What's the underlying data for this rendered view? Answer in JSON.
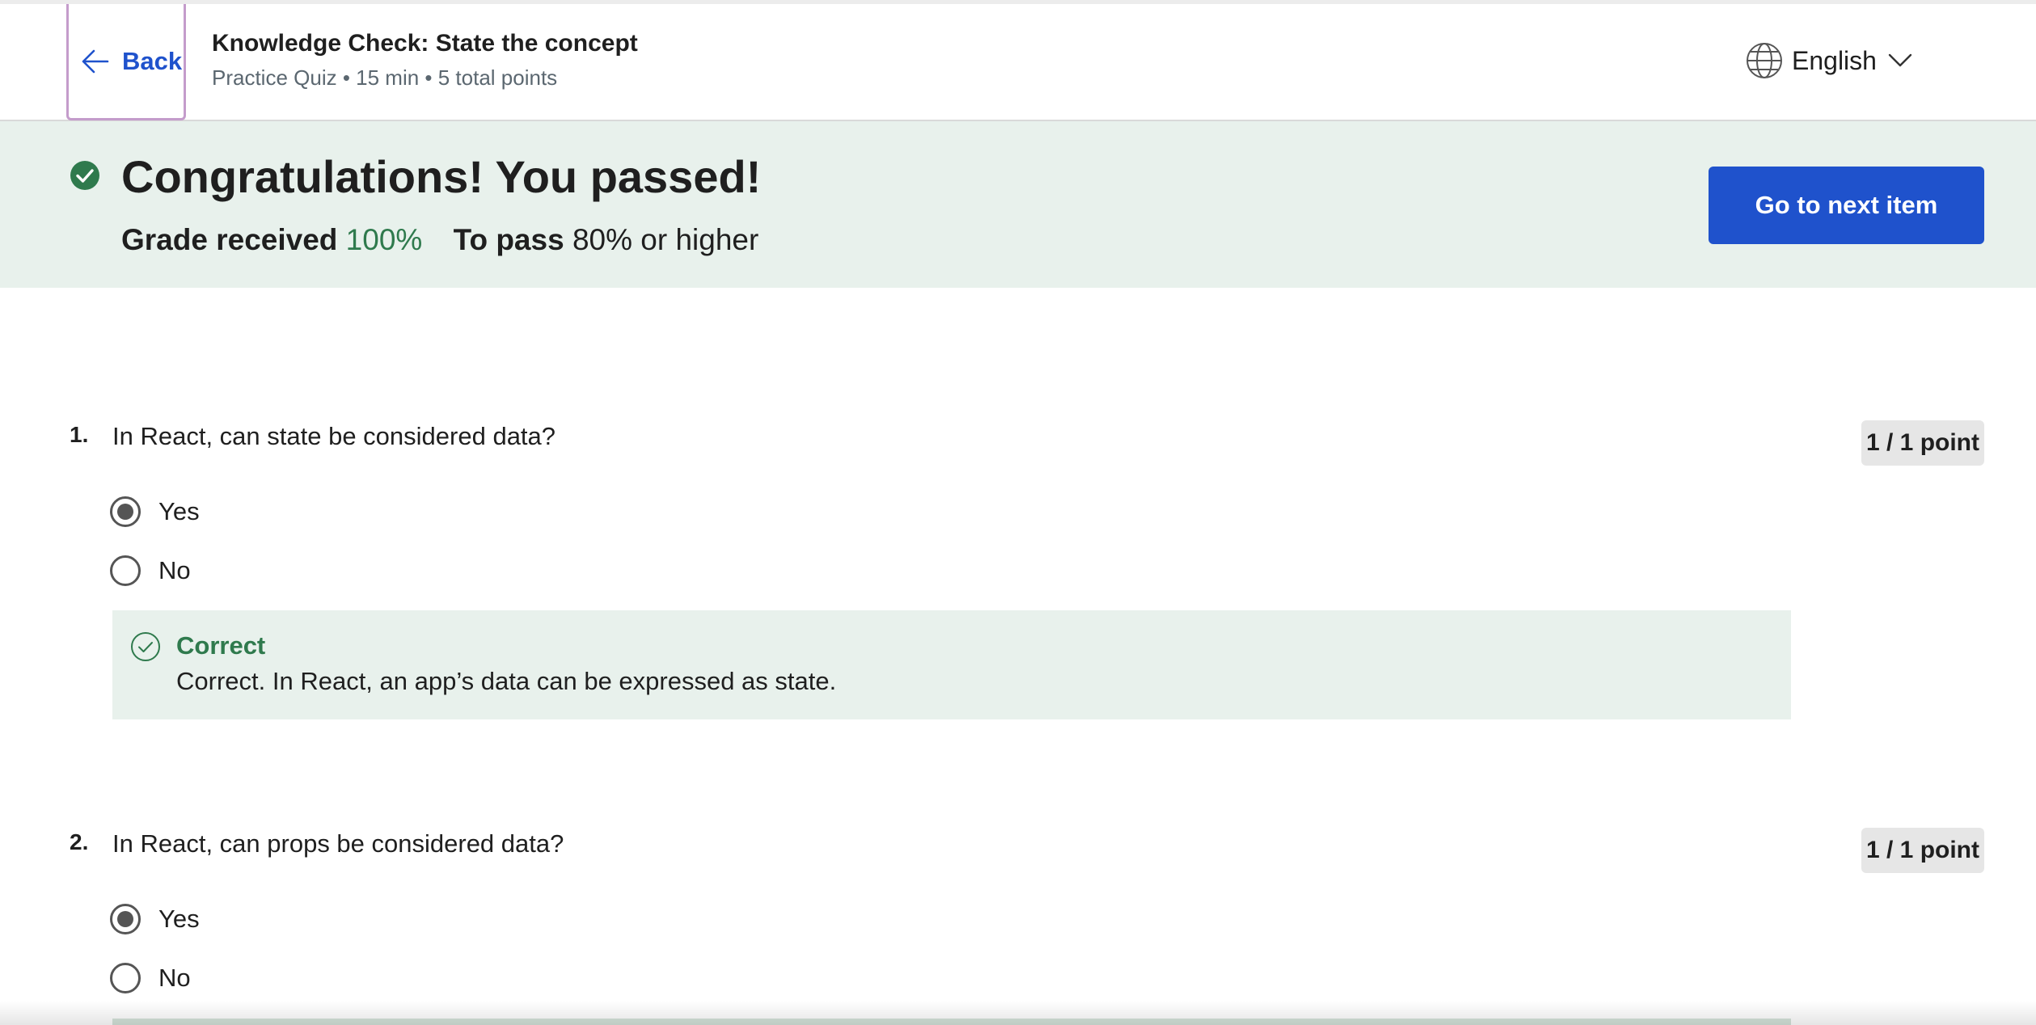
{
  "header": {
    "back_label": "Back",
    "quiz_title": "Knowledge Check: State the concept",
    "quiz_meta": "Practice Quiz • 15 min • 5 total points",
    "language": "English"
  },
  "banner": {
    "heading": "Congratulations! You passed!",
    "grade_label": "Grade received",
    "grade_value": "100%",
    "pass_label": "To pass",
    "pass_value": "80% or higher",
    "next_button": "Go to next item"
  },
  "questions": [
    {
      "number": "1.",
      "text": "In React, can state be considered data?",
      "points": "1 / 1 point",
      "options": [
        {
          "label": "Yes",
          "selected": true
        },
        {
          "label": "No",
          "selected": false
        }
      ],
      "feedback": {
        "title": "Correct",
        "text": "Correct. In React, an app’s data can be expressed as state."
      }
    },
    {
      "number": "2.",
      "text": "In React, can props be considered data?",
      "points": "1 / 1 point",
      "options": [
        {
          "label": "Yes",
          "selected": true
        },
        {
          "label": "No",
          "selected": false
        }
      ]
    }
  ],
  "colors": {
    "accent_blue": "#1f52cc",
    "success_green": "#2f7a4d",
    "banner_bg": "#e8f1ec"
  },
  "icons": {
    "back": "arrow-left-icon",
    "language": "globe-icon",
    "dropdown": "chevron-down-icon",
    "passed": "check-circle-filled-icon",
    "correct": "check-circle-outline-icon"
  }
}
